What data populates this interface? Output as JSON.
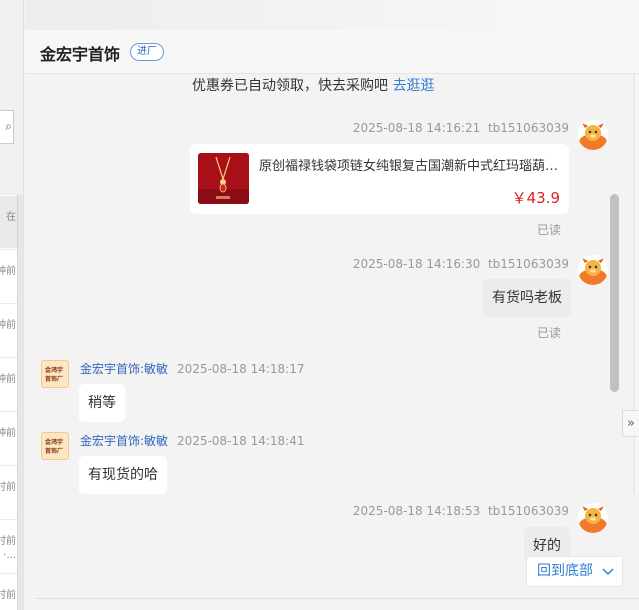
{
  "shop": {
    "name": "金宏宇首饰",
    "badge": "进厂"
  },
  "notice": {
    "text": "优惠券已自动领取，快去采购吧 ",
    "link": "去逛逛"
  },
  "left_list": {
    "search_icon": "search-icon",
    "items": [
      {
        "time": "在"
      },
      {
        "time": "钟前"
      },
      {
        "time": "钟前"
      },
      {
        "time": "钟前"
      },
      {
        "time": "钟前"
      },
      {
        "time": "时前"
      },
      {
        "time": "时前",
        "sub": "·..."
      },
      {
        "time": "时前"
      }
    ]
  },
  "messages": {
    "m1": {
      "time": "2025-08-18 14:16:21",
      "user": "tb151063039"
    },
    "product": {
      "title": "原创福禄钱袋项链女纯银复古国潮新中式红玛瑙葫芦锁...",
      "price": "￥43.9"
    },
    "m1_read": "已读",
    "m2": {
      "time": "2025-08-18 14:16:30",
      "user": "tb151063039",
      "text": "有货吗老板",
      "read": "已读"
    },
    "m3": {
      "sender": "金宏宇首饰:敏敏",
      "time": "2025-08-18 14:18:17",
      "text": "稍等"
    },
    "m4": {
      "sender": "金宏宇首饰:敏敏",
      "time": "2025-08-18 14:18:41",
      "text": "有现货的哈"
    },
    "m5": {
      "time": "2025-08-18 14:18:53",
      "user": "tb151063039",
      "text": "好的"
    }
  },
  "shop_avatar": {
    "line1": "金鸿宇",
    "line2": "首饰厂"
  },
  "controls": {
    "back_to_bottom": "回到底部",
    "collapse_icon": "double-chevron-right-icon"
  },
  "colors": {
    "accent": "#2f7fd4",
    "price": "#e02020",
    "sender": "#3366bb"
  }
}
